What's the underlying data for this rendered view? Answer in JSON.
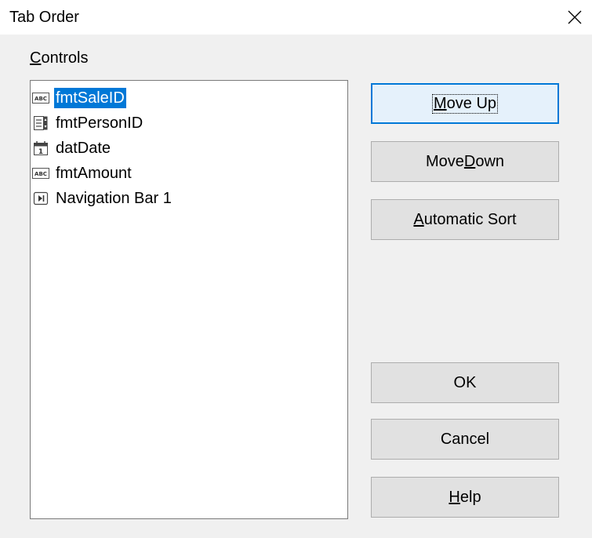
{
  "window": {
    "title": "Tab Order"
  },
  "controls": {
    "label_pre": "",
    "label_mnemonic": "C",
    "label_post": "ontrols",
    "items": [
      {
        "label": "fmtSaleID",
        "icon": "text-field-icon",
        "selected": true
      },
      {
        "label": "fmtPersonID",
        "icon": "numeric-field-icon",
        "selected": false
      },
      {
        "label": "datDate",
        "icon": "date-field-icon",
        "selected": false
      },
      {
        "label": "fmtAmount",
        "icon": "text-field-icon",
        "selected": false
      },
      {
        "label": "Navigation Bar 1",
        "icon": "navigation-bar-icon",
        "selected": false
      }
    ]
  },
  "buttons": {
    "move_up": {
      "pre": "",
      "mnemonic": "M",
      "post": "ove Up"
    },
    "move_down": {
      "pre": "Move ",
      "mnemonic": "D",
      "post": "own"
    },
    "automatic_sort": {
      "pre": "",
      "mnemonic": "A",
      "post": "utomatic Sort"
    },
    "ok": {
      "label": "OK"
    },
    "cancel": {
      "label": "Cancel"
    },
    "help": {
      "pre": "",
      "mnemonic": "H",
      "post": "elp"
    }
  },
  "colors": {
    "selection": "#0078d7",
    "button_face": "#e1e1e1",
    "dialog_bg": "#f0f0f0"
  }
}
